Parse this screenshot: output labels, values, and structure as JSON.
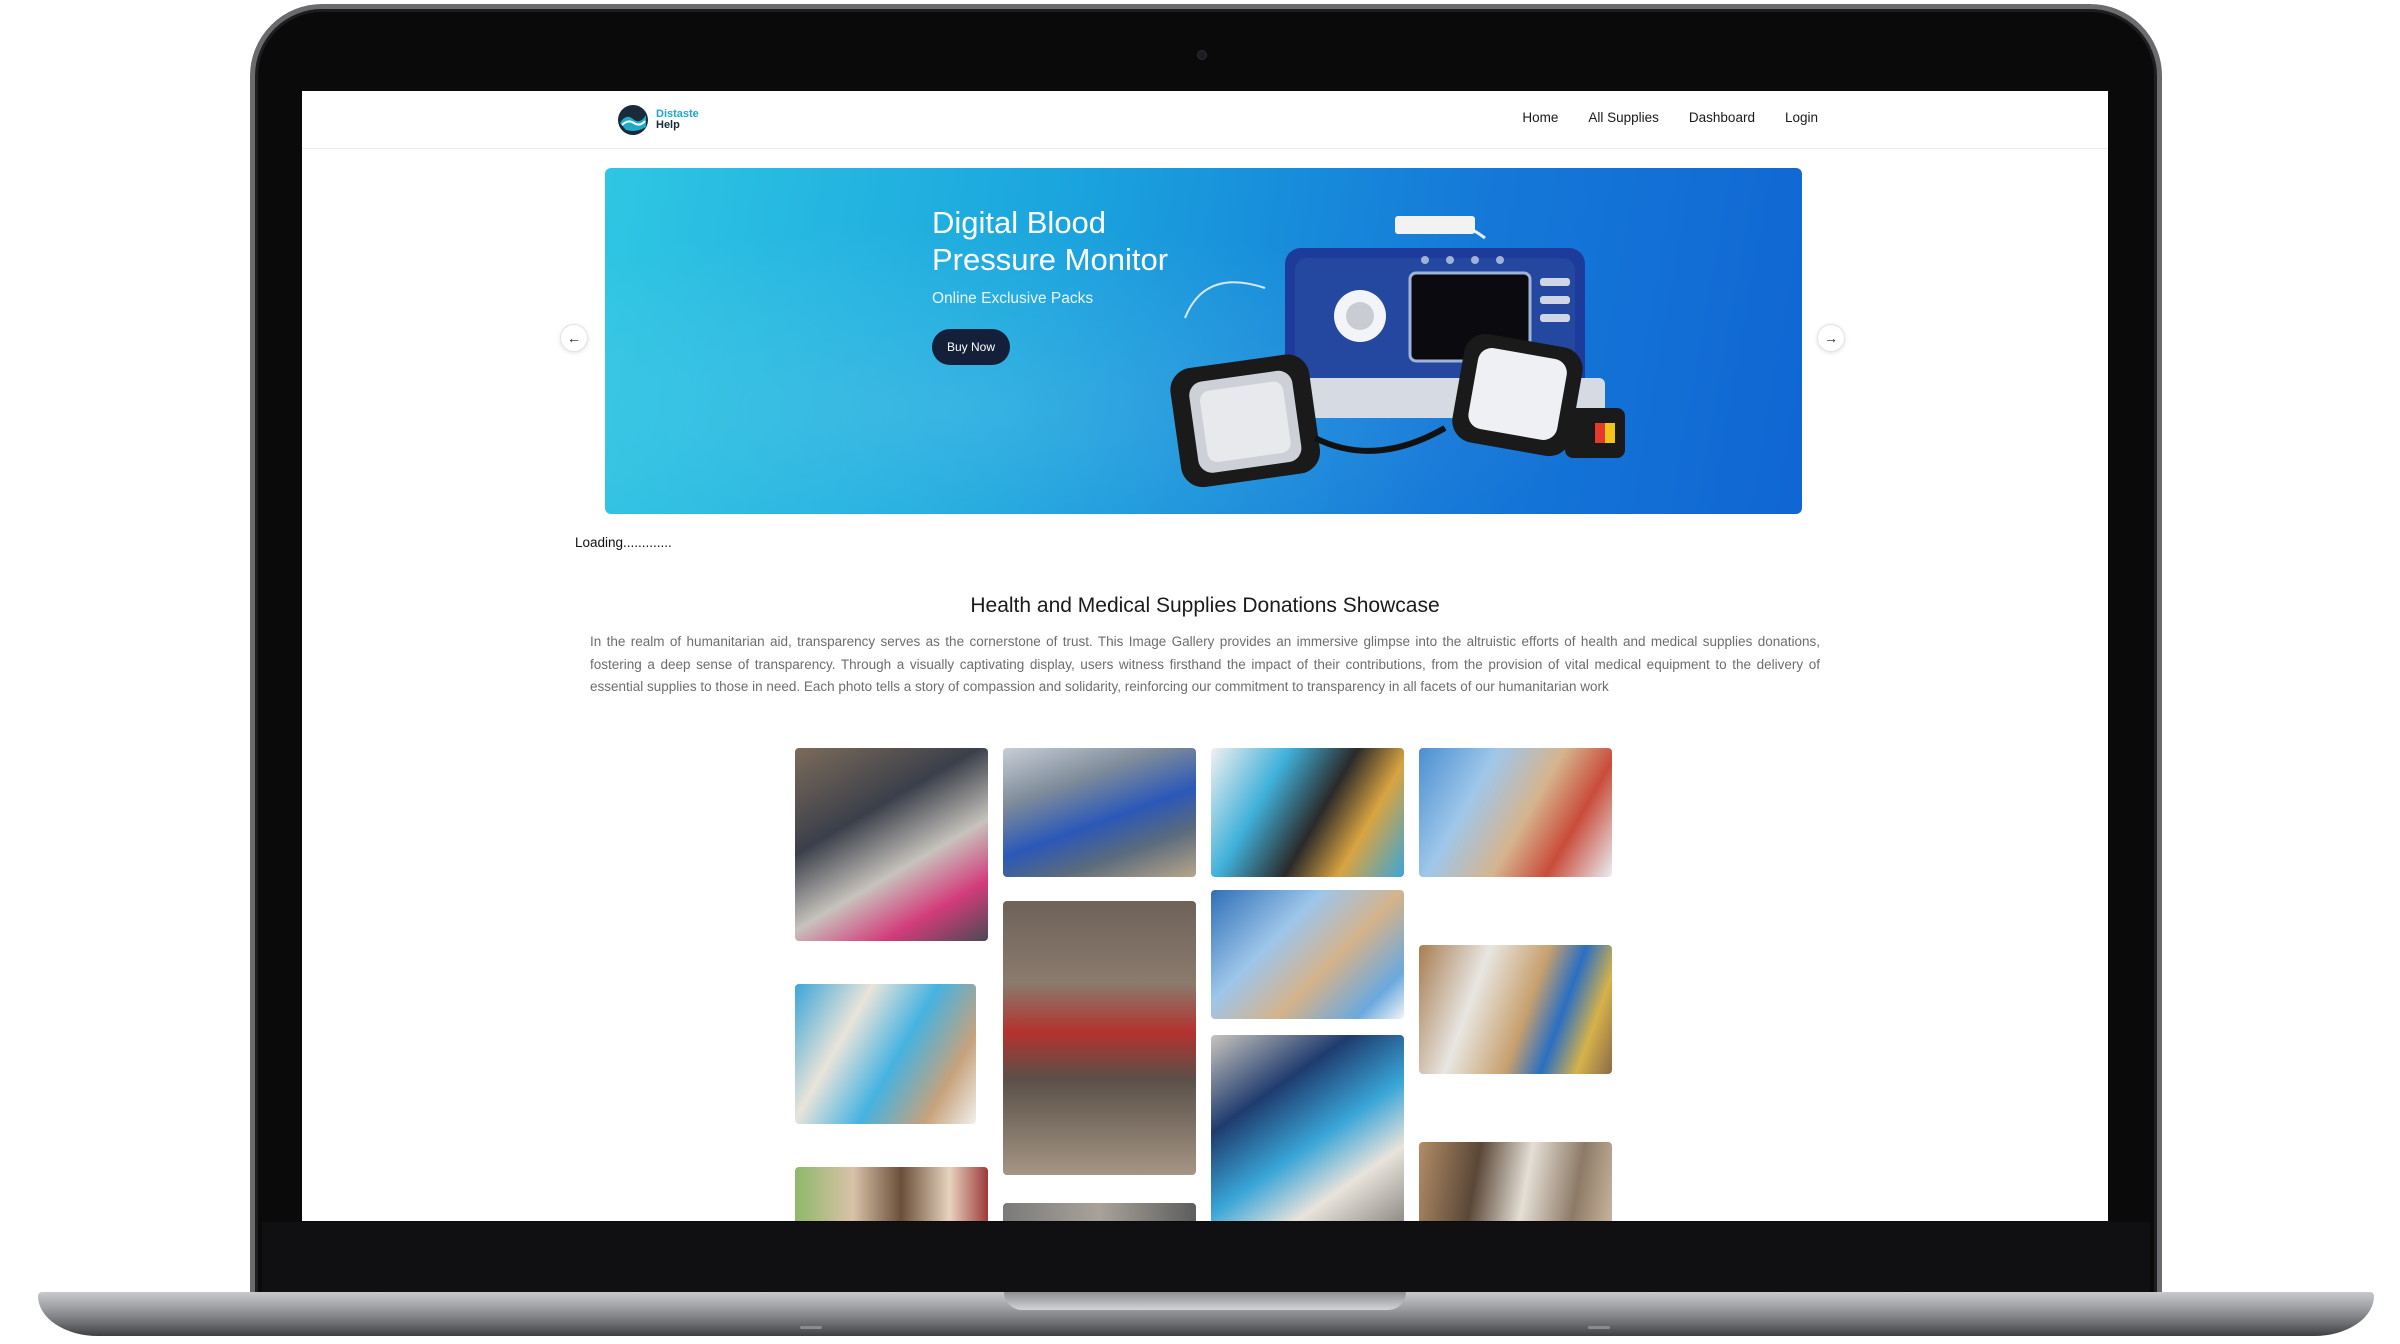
{
  "brand": {
    "line1": "Distaste",
    "line2": "Help"
  },
  "nav": {
    "items": [
      "Home",
      "All Supplies",
      "Dashboard",
      "Login"
    ]
  },
  "hero": {
    "title": "Digital Blood Pressure Monitor",
    "subtitle": "Online Exclusive Packs",
    "cta": "Buy Now",
    "prev_icon": "arrow-left-icon",
    "next_icon": "arrow-right-icon"
  },
  "status": {
    "loading": "Loading............."
  },
  "showcase": {
    "title": "Health and Medical Supplies Donations Showcase",
    "body": "In the realm of humanitarian aid, transparency serves as the cornerstone of trust. This Image Gallery provides an immersive glimpse into the altruistic efforts of health and medical supplies donations, fostering a deep sense of transparency. Through a visually captivating display, users witness firsthand the impact of their contributions, from the provision of vital medical equipment to the delivery of essential supplies to those in need. Each photo tells a story of compassion and solidarity, reinforcing our commitment to transparency in all facets of our humanitarian work"
  },
  "colors": {
    "accent": "#1ea9c8",
    "button_dark": "#14203a",
    "hero_start": "#2fc6e3",
    "hero_end": "#1066d3",
    "volunteer_blue": "#3aa6d8"
  },
  "gallery": {
    "photos": [
      "crowd-sitting-photo",
      "tents-crowd-photo",
      "volunteers-table-photo",
      "volunteers-boxes-photo",
      "volunteers-packing-photo",
      "woman-rubble-photo",
      "volunteers-boxes-2-photo",
      "temperature-check-photo",
      "group-smiling-photo",
      "street-crowd-photo",
      "volunteer-helping-photo",
      "clinic-photo"
    ]
  }
}
